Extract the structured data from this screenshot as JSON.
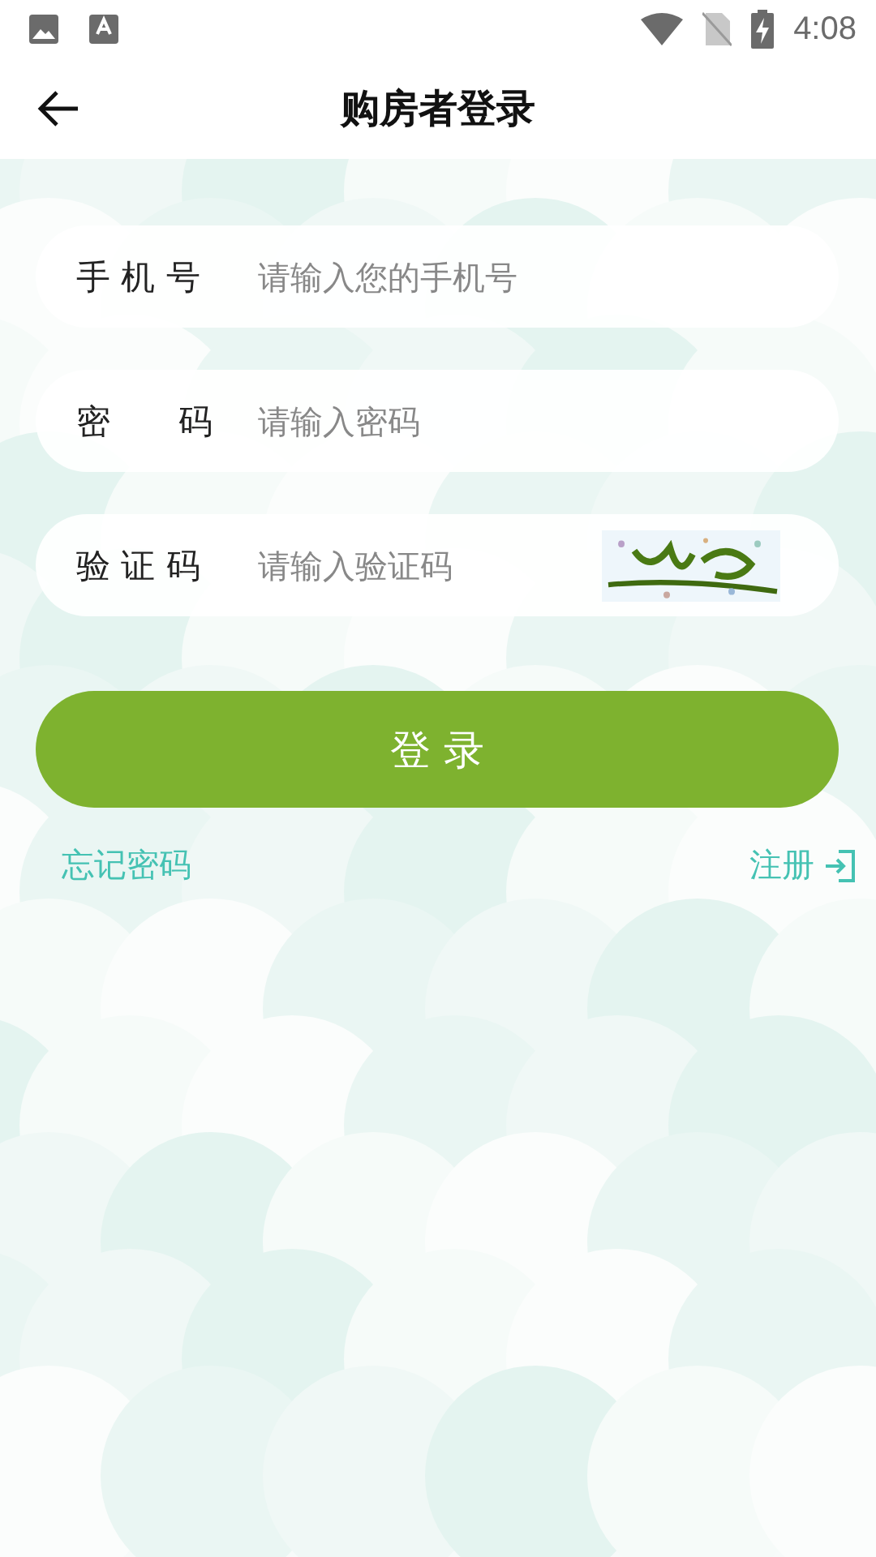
{
  "status_bar": {
    "time": "4:08"
  },
  "header": {
    "title": "购房者登录"
  },
  "fields": [
    {
      "kind": "text",
      "label": "手 机 号",
      "placeholder": "请输入您的手机号"
    },
    {
      "kind": "text",
      "label": "密　　码",
      "placeholder": "请输入密码"
    },
    {
      "kind": "captcha",
      "label": "验 证 码",
      "placeholder": "请输入验证码"
    }
  ],
  "login_button": {
    "label": "登 录"
  },
  "links": {
    "forgot": "忘记密码",
    "register": "注册"
  }
}
